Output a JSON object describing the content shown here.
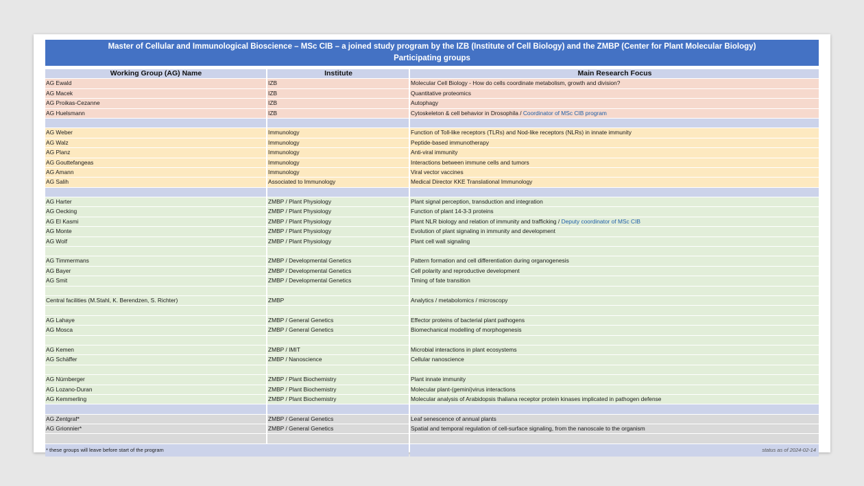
{
  "title": {
    "line1": "Master of Cellular and Immunological Bioscience – MSc CIB  – a joined study program by the IZB (Institute of Cell Biology) and the ZMBP (Center for Plant Molecular Biology)",
    "line2": "Participating groups"
  },
  "headers": {
    "name": "Working Group (AG) Name",
    "institute": "Institute",
    "focus": "Main Research Focus"
  },
  "rows": [
    {
      "tint": "izb",
      "name": "AG Ewald",
      "institute": "IZB",
      "focus": "Molecular Cell Biology - How do cells coordinate metabolism, growth and division?",
      "note": ""
    },
    {
      "tint": "izb",
      "name": "AG Macek",
      "institute": "IZB",
      "focus": "Quantitative proteomics",
      "note": ""
    },
    {
      "tint": "izb",
      "name": "AG Proikas-Cezanne",
      "institute": "IZB",
      "focus": "Autophagy",
      "note": ""
    },
    {
      "tint": "izb",
      "name": "AG Huelsmann",
      "institute": "IZB",
      "focus": "Cytoskeleton & cell behavior in Drosophila / ",
      "note": "Coordinator of MSc CIB program"
    },
    {
      "tint": "sep",
      "name": "",
      "institute": "",
      "focus": "",
      "note": ""
    },
    {
      "tint": "imm",
      "name": "AG Weber",
      "institute": "Immunology",
      "focus": "Function of Toll-like receptors (TLRs) and Nod-like receptors (NLRs) in innate immunity",
      "note": ""
    },
    {
      "tint": "imm",
      "name": "AG Walz",
      "institute": "Immunology",
      "focus": "Peptide-based immunotherapy",
      "note": ""
    },
    {
      "tint": "imm",
      "name": "AG Planz",
      "institute": "Immunology",
      "focus": "Anti-viral immunity",
      "note": ""
    },
    {
      "tint": "imm",
      "name": "AG Gouttefangeas",
      "institute": "Immunology",
      "focus": "Interactions between immune cells and tumors",
      "note": ""
    },
    {
      "tint": "imm",
      "name": "AG Amann",
      "institute": "Immunology",
      "focus": "Viral vector vaccines",
      "note": ""
    },
    {
      "tint": "imm",
      "name": "AG Salih",
      "institute": "Associated to Immunology",
      "focus": "Medical Director KKE Translational Immunology",
      "note": ""
    },
    {
      "tint": "sep",
      "name": "",
      "institute": "",
      "focus": "",
      "note": ""
    },
    {
      "tint": "plant",
      "name": "AG Harter",
      "institute": "ZMBP / Plant Physiology",
      "focus": "Plant signal perception, transduction and integration",
      "note": ""
    },
    {
      "tint": "plant",
      "name": "AG Oecking",
      "institute": "ZMBP / Plant Physiology",
      "focus": "Function of plant 14-3-3 proteins",
      "note": ""
    },
    {
      "tint": "plant",
      "name": "AG El Kasmi",
      "institute": "ZMBP / Plant Physiology",
      "focus": "Plant NLR biology and relation of immunity and trafficking / ",
      "note": "Deputy coordinator of MSc CIB"
    },
    {
      "tint": "plant",
      "name": "AG Monte",
      "institute": "ZMBP / Plant Physiology",
      "focus": "Evolution of plant signaling in immunity and development",
      "note": ""
    },
    {
      "tint": "plant",
      "name": "AG Wolf",
      "institute": "ZMBP / Plant Physiology",
      "focus": "Plant cell wall signaling",
      "note": ""
    },
    {
      "tint": "plant",
      "name": "",
      "institute": "",
      "focus": "",
      "note": ""
    },
    {
      "tint": "plant",
      "name": "AG Timmermans",
      "institute": "ZMBP / Developmental Genetics",
      "focus": "Pattern formation and cell differentiation during organogenesis",
      "note": ""
    },
    {
      "tint": "plant",
      "name": "AG Bayer",
      "institute": "ZMBP / Developmental Genetics",
      "focus": "Cell polarity and reproductive development",
      "note": ""
    },
    {
      "tint": "plant",
      "name": "AG Smit",
      "institute": "ZMBP / Developmental Genetics",
      "focus": "Timing of fate transition",
      "note": ""
    },
    {
      "tint": "plant",
      "name": "",
      "institute": "",
      "focus": "",
      "note": ""
    },
    {
      "tint": "plant",
      "name": "Central facilities (M.Stahl, K. Berendzen, S. Richter)",
      "institute": "ZMBP",
      "focus": "Analytics / metabolomics / microscopy",
      "note": ""
    },
    {
      "tint": "plant",
      "name": "",
      "institute": "",
      "focus": "",
      "note": ""
    },
    {
      "tint": "plant",
      "name": "AG Lahaye",
      "institute": "ZMBP / General Genetics",
      "focus": "Effector proteins of bacterial plant pathogens",
      "note": ""
    },
    {
      "tint": "plant",
      "name": "AG Mosca",
      "institute": "ZMBP / General Genetics",
      "focus": "Biomechanical modelling of morphogenesis",
      "note": ""
    },
    {
      "tint": "plant",
      "name": "",
      "institute": "",
      "focus": "",
      "note": ""
    },
    {
      "tint": "plant",
      "name": "AG Kemen",
      "institute": "ZMBP / IMIT",
      "focus": "Microbial interactions in plant ecosystems",
      "note": ""
    },
    {
      "tint": "plant",
      "name": "AG Schäffer",
      "institute": "ZMBP / Nanoscience",
      "focus": "Cellular nanoscience",
      "note": ""
    },
    {
      "tint": "plant",
      "name": "",
      "institute": "",
      "focus": "",
      "note": ""
    },
    {
      "tint": "plant",
      "name": "AG Nürnberger",
      "institute": "ZMBP / Plant Biochemistry",
      "focus": "Plant innate immunity",
      "note": ""
    },
    {
      "tint": "plant",
      "name": "AG Lozano-Duran",
      "institute": "ZMBP / Plant Biochemistry",
      "focus": "Molecular plant-(gemini)virus interactions",
      "note": ""
    },
    {
      "tint": "plant",
      "name": "AG Kemmerling",
      "institute": "ZMBP / Plant Biochemistry",
      "focus": "Molecular analysis of Arabidopsis thaliana receptor protein kinases implicated in pathogen defense",
      "note": ""
    },
    {
      "tint": "sep",
      "name": "",
      "institute": "",
      "focus": "",
      "note": ""
    },
    {
      "tint": "grey",
      "name": "AG Zentgraf*",
      "institute": "ZMBP / General Genetics",
      "focus": "Leaf senescence of annual plants",
      "note": ""
    },
    {
      "tint": "grey",
      "name": "AG Grionnier*",
      "institute": "ZMBP / General Genetics",
      "focus": "Spatial and temporal regulation of cell-surface signaling, from the nanoscale to the organism",
      "note": ""
    },
    {
      "tint": "grey",
      "name": "",
      "institute": "",
      "focus": "",
      "note": ""
    }
  ],
  "footer": {
    "note": "* these groups will leave before start of the program",
    "status": "status as of 2024-02-14"
  },
  "colors": {
    "banner": "#4472c4",
    "header": "#ccd3ea",
    "izb": "#f6d9cd",
    "immunology": "#fde9c0",
    "plant": "#e2eed9",
    "leaving": "#d9d9d9",
    "link": "#1f5fa8"
  }
}
